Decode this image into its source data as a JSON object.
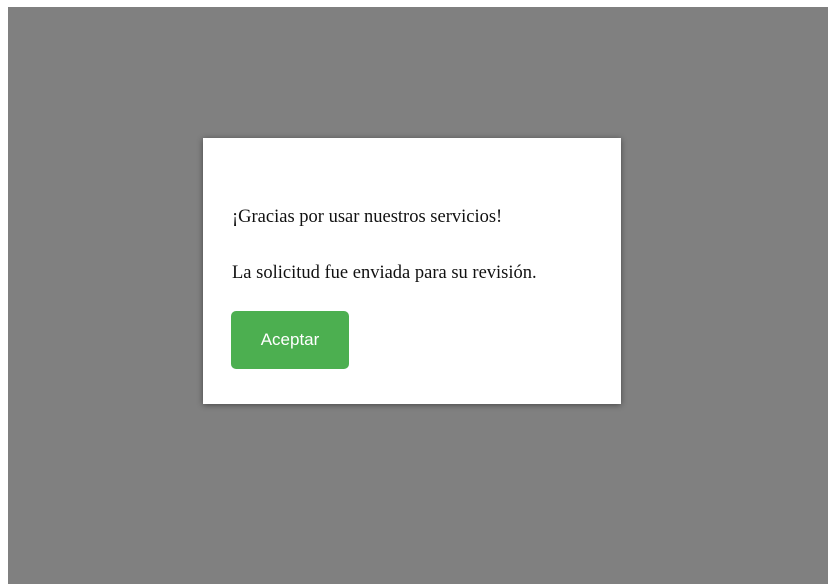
{
  "dialog": {
    "message_line1": "¡Gracias por usar nuestros servicios!",
    "message_line2": "La solicitud fue enviada para su revisión.",
    "accept_label": "Aceptar"
  },
  "colors": {
    "overlay": "#808080",
    "dialog_background": "#ffffff",
    "accept_button": "#4caf50",
    "accept_button_text": "#ffffff"
  }
}
